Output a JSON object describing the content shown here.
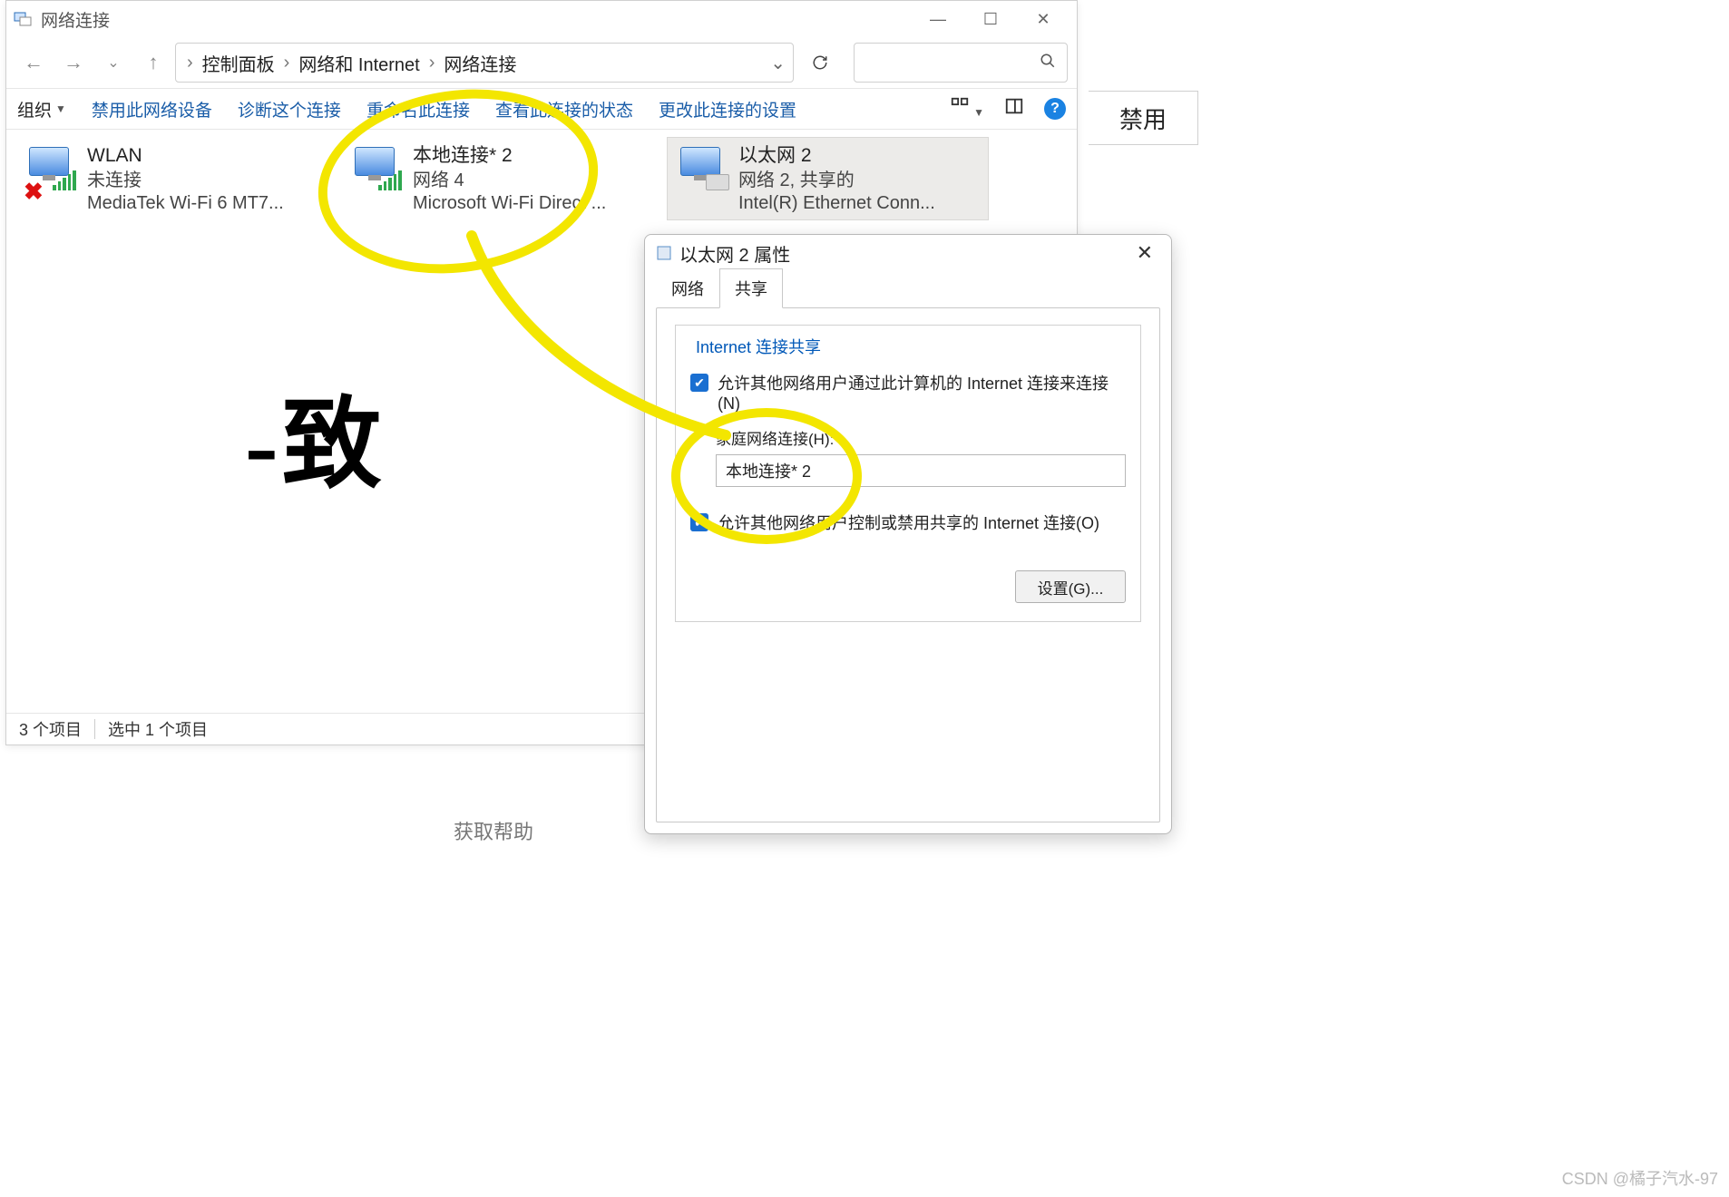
{
  "window": {
    "title": "网络连接",
    "controls": {
      "min": "—",
      "max": "☐",
      "close": "✕"
    }
  },
  "breadcrumb": {
    "items": [
      "控制面板",
      "网络和 Internet",
      "网络连接"
    ]
  },
  "toolbar": {
    "organize": "组织",
    "disable": "禁用此网络设备",
    "diagnose": "诊断这个连接",
    "rename": "重命名此连接",
    "viewstatus": "查看此连接的状态",
    "changeset": "更改此连接的设置"
  },
  "connections": [
    {
      "name": "WLAN",
      "status": "未连接",
      "device": "MediaTek Wi-Fi 6 MT7..."
    },
    {
      "name": "本地连接* 2",
      "status": "网络 4",
      "device": "Microsoft Wi-Fi Direct ..."
    },
    {
      "name": "以太网 2",
      "status": "网络 2, 共享的",
      "device": "Intel(R) Ethernet Conn..."
    }
  ],
  "statusbar": {
    "count": "3 个项目",
    "selected": "选中 1 个项目"
  },
  "side_button": "禁用",
  "dialog": {
    "title": "以太网 2 属性",
    "tabs": {
      "net": "网络",
      "share": "共享"
    },
    "group_title": "Internet 连接共享",
    "chk1": "允许其他网络用户通过此计算机的 Internet 连接来连接(N)",
    "home_lbl": "家庭网络连接(H):",
    "home_val": "本地连接* 2",
    "chk2": "允许其他网络用户控制或禁用共享的 Internet 连接(O)",
    "settings_btn": "设置(G)..."
  },
  "handwriting": "-致",
  "watermark": "CSDN @橘子汽水-97",
  "partial_text": "获取帮助"
}
